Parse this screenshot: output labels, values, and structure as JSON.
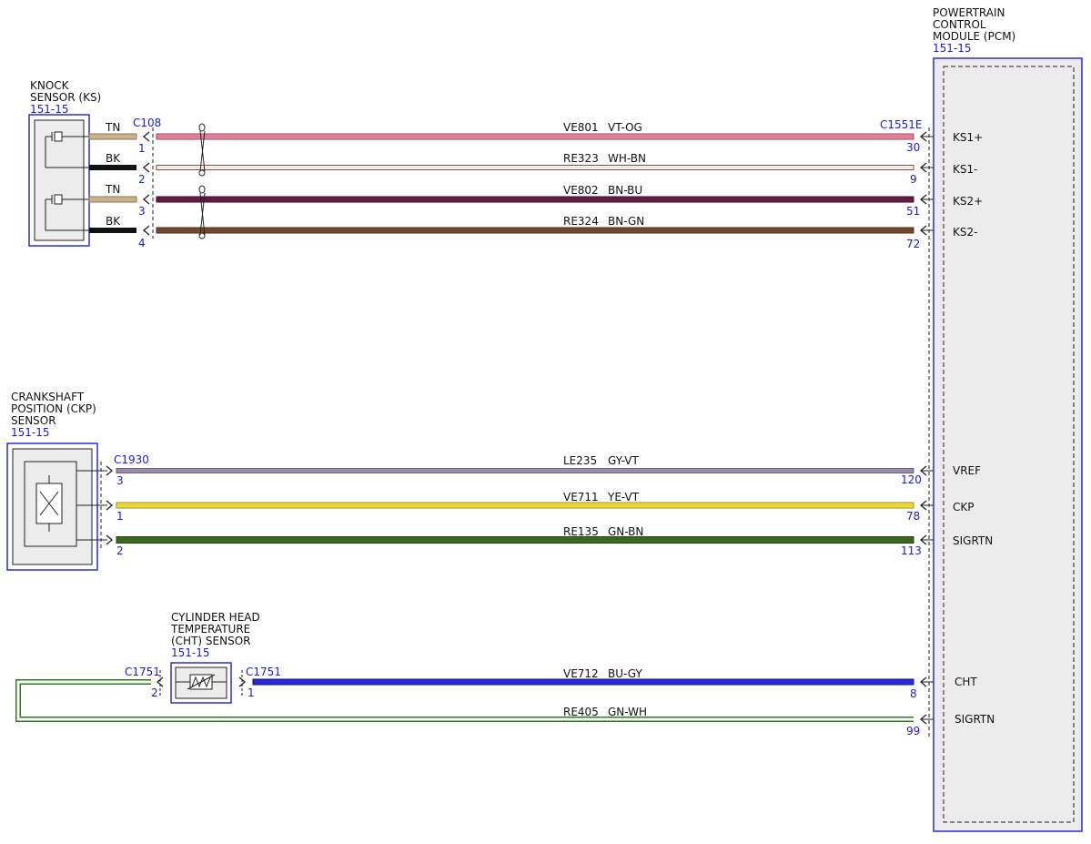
{
  "pcm": {
    "title": [
      "POWERTRAIN",
      "CONTROL",
      "MODULE (PCM)"
    ],
    "ref": "151-15",
    "connector": "C1551E",
    "signals": {
      "ks1p": "KS1+",
      "ks1m": "KS1-",
      "ks2p": "KS2+",
      "ks2m": "KS2-",
      "vref": "VREF",
      "ckp": "CKP",
      "sigrtn1": "SIGRTN",
      "cht": "CHT",
      "sigrtn2": "SIGRTN"
    }
  },
  "knock_sensor": {
    "title": [
      "KNOCK",
      "SENSOR (KS)"
    ],
    "ref": "151-15",
    "connector": "C108",
    "leads": [
      "TN",
      "BK",
      "TN",
      "BK"
    ]
  },
  "ckp_sensor": {
    "title": [
      "CRANKSHAFT",
      "POSITION (CKP)",
      "SENSOR"
    ],
    "ref": "151-15",
    "connector": "C1930"
  },
  "cht_sensor": {
    "title": [
      "CYLINDER HEAD",
      "TEMPERATURE",
      "(CHT) SENSOR"
    ],
    "ref": "151-15",
    "connector_left": "C1751",
    "connector_right": "C1751"
  },
  "wires": [
    {
      "circuit": "VE801",
      "color_code": "VT-OG",
      "color": "#e8859e",
      "stroke": "#9a4e62",
      "pin_left": "1",
      "pin_right": "30"
    },
    {
      "circuit": "RE323",
      "color_code": "WH-BN",
      "color": "#ffffff",
      "stroke": "#8b4a3a",
      "pin_left": "2",
      "pin_right": "9"
    },
    {
      "circuit": "VE802",
      "color_code": "BN-BU",
      "color": "#6a1a45",
      "stroke": "#3a0f28",
      "pin_left": "3",
      "pin_right": "51"
    },
    {
      "circuit": "RE324",
      "color_code": "BN-GN",
      "color": "#7a4a2e",
      "stroke": "#4a2c1a",
      "pin_left": "4",
      "pin_right": "72"
    },
    {
      "circuit": "LE235",
      "color_code": "GY-VT",
      "color": "#a090a8",
      "stroke": "#6a5a74",
      "pin_left": "3",
      "pin_right": "120"
    },
    {
      "circuit": "VE711",
      "color_code": "YE-VT",
      "color": "#f2e040",
      "stroke": "#a08a10",
      "pin_left": "1",
      "pin_right": "78"
    },
    {
      "circuit": "RE135",
      "color_code": "GN-BN",
      "color": "#3a6a1e",
      "stroke": "#24440f",
      "pin_left": "2",
      "pin_right": "113"
    },
    {
      "circuit": "VE712",
      "color_code": "BU-GY",
      "color": "#2a2ae0",
      "stroke": "#10108a",
      "pin_left": "1",
      "pin_right": "8"
    },
    {
      "circuit": "RE405",
      "color_code": "GN-WH",
      "color": "#ffffff",
      "stroke": "#2e7a1e",
      "pin_left": "2",
      "pin_right": "99"
    }
  ]
}
